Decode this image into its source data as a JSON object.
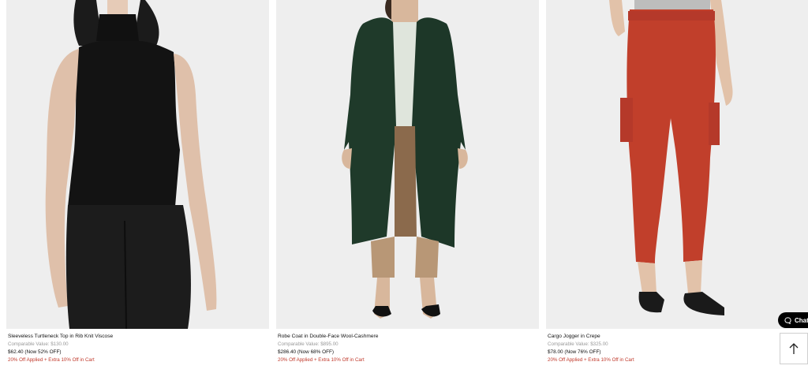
{
  "products": [
    {
      "name": "Sleeveless Turtleneck Top in Rib Knit Viscose",
      "comparable": "Comparable Value: $130.00",
      "price": "$62.40 (Now 52% OFF)",
      "promo": "20% Off Applied + Extra 10% Off in Cart"
    },
    {
      "name": "Robe Coat in Double-Face Wool-Cashmere",
      "comparable": "Comparable Value: $895.00",
      "price": "$286.40 (Now 68% OFF)",
      "promo": "20% Off Applied + Extra 10% Off in Cart"
    },
    {
      "name": "Cargo Jogger in Crepe",
      "comparable": "Comparable Value: $325.00",
      "price": "$78.00 (Now 76% OFF)",
      "promo": "20% Off Applied + Extra 10% Off in Cart"
    }
  ],
  "chat": {
    "label": "Chat",
    "icon": "chat-bubble-icon"
  },
  "back_to_top": {
    "icon": "arrow-up-icon"
  },
  "colors": {
    "promo": "#c0392b",
    "muted": "#9a9a9a",
    "photo_bg": "#eeeeee"
  }
}
